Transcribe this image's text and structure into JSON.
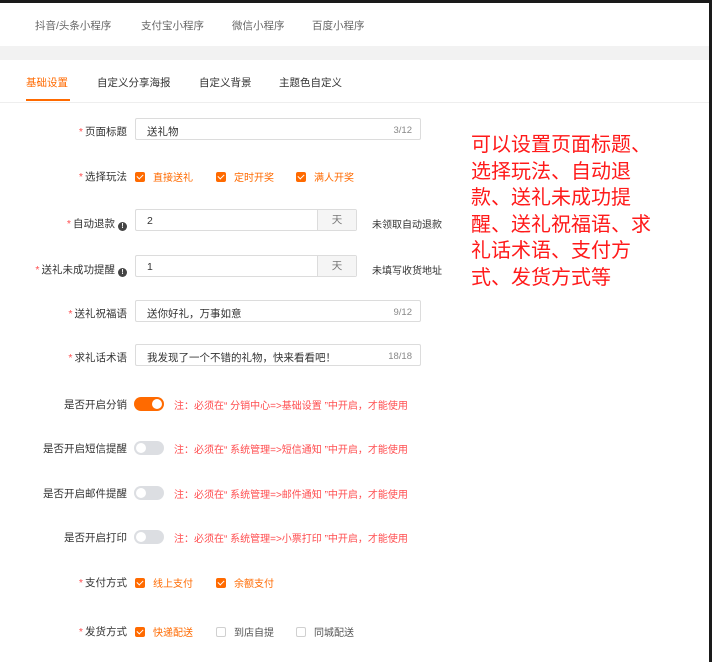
{
  "platform_tabs": [
    "抖音/头条小程序",
    "支付宝小程序",
    "微信小程序",
    "百度小程序"
  ],
  "sub_tabs": [
    {
      "label": "基础设置",
      "active": true
    },
    {
      "label": "自定义分享海报",
      "active": false
    },
    {
      "label": "自定义背景",
      "active": false
    },
    {
      "label": "主题色自定义",
      "active": false
    }
  ],
  "form": {
    "page_title": {
      "label": "页面标题",
      "value": "送礼物",
      "count": "3/12"
    },
    "play_mode": {
      "label": "选择玩法",
      "options": [
        {
          "label": "直接送礼",
          "checked": true
        },
        {
          "label": "定时开奖",
          "checked": true
        },
        {
          "label": "满人开奖",
          "checked": true
        }
      ]
    },
    "auto_refund": {
      "label": "自动退款",
      "value": "2",
      "unit": "天",
      "after": "未领取自动退款"
    },
    "fail_reminder": {
      "label": "送礼未成功提醒",
      "value": "1",
      "unit": "天",
      "after": "未填写收货地址"
    },
    "blessing": {
      "label": "送礼祝福语",
      "value": "送你好礼，万事如意",
      "count": "9/12"
    },
    "request_text": {
      "label": "求礼话术语",
      "value": "我发现了一个不错的礼物，快来看看吧！",
      "count": "18/18"
    },
    "toggles": [
      {
        "label": "是否开启分销",
        "on": true,
        "note": "注：必须在“ 分销中心=>基础设置 ”中开启，才能使用"
      },
      {
        "label": "是否开启短信提醒",
        "on": false,
        "note": "注：必须在“ 系统管理=>短信通知 ”中开启，才能使用"
      },
      {
        "label": "是否开启邮件提醒",
        "on": false,
        "note": "注：必须在“ 系统管理=>邮件通知 ”中开启，才能使用"
      },
      {
        "label": "是否开启打印",
        "on": false,
        "note": "注：必须在“ 系统管理=>小票打印 ”中开启，才能使用"
      }
    ],
    "payment": {
      "label": "支付方式",
      "options": [
        {
          "label": "线上支付",
          "checked": true
        },
        {
          "label": "余额支付",
          "checked": true
        }
      ]
    },
    "delivery": {
      "label": "发货方式",
      "options": [
        {
          "label": "快递配送",
          "checked": true
        },
        {
          "label": "到店自提",
          "checked": false
        },
        {
          "label": "同城配送",
          "checked": false
        }
      ]
    }
  },
  "annotation": {
    "lines": [
      "可以设置页面标题、",
      "选择玩法、自动退",
      "款、送礼未成功提",
      "醒、送礼祝福语、求",
      "礼话术语、支付方",
      "式、发货方式等"
    ]
  },
  "colors": {
    "accent": "#ff6a00",
    "note": "#ff4d4f",
    "annotation": "#ff1a1a"
  }
}
